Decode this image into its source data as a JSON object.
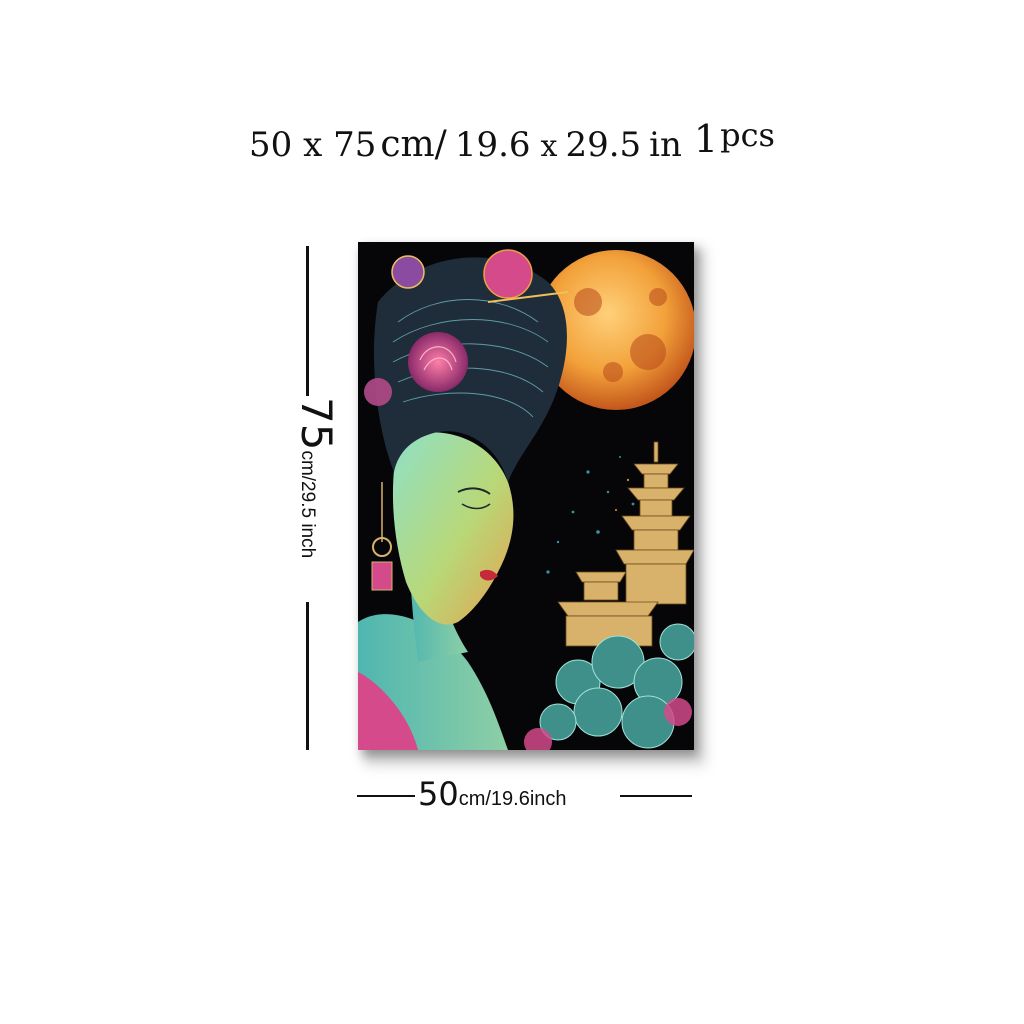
{
  "header": {
    "part_a": "50 x 75",
    "part_b": "cm/",
    "part_c": "19.6",
    "part_d": "x",
    "part_e": "29.5",
    "part_f": "in",
    "part_g": "1",
    "part_h": "pcs"
  },
  "height_dimension": {
    "value": "75",
    "unit": "cm/29.5 inch"
  },
  "width_dimension": {
    "value": "50",
    "unit": "cm/19.6inch"
  },
  "artwork": {
    "icon": "geisha-moon-pagoda-painting",
    "colors": {
      "background": "#060608",
      "moon": "#f2a13a",
      "skin": "#7cc9b8",
      "flower": "#d44a8a",
      "pagoda": "#d8b26a",
      "cloud": "#3f8f8a"
    }
  }
}
